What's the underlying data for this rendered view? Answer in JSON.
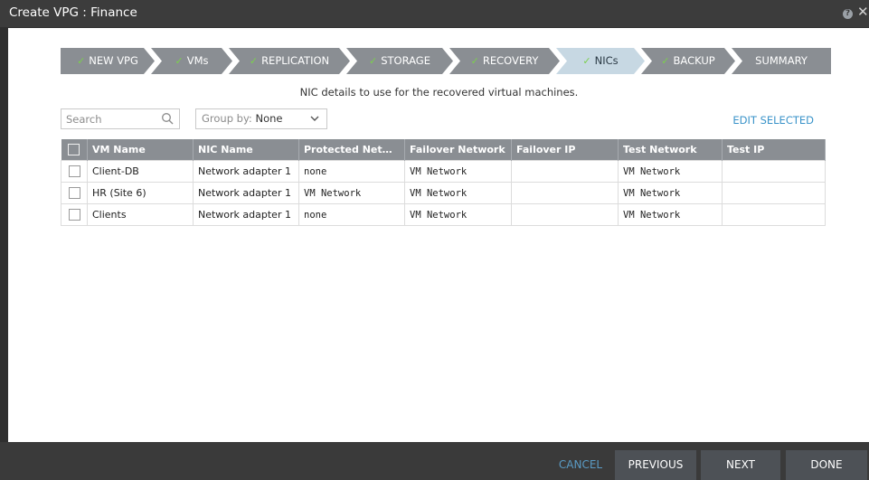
{
  "window": {
    "title": "Create VPG : Finance"
  },
  "wizard": {
    "steps": [
      {
        "label": "NEW VPG",
        "done": true
      },
      {
        "label": "VMs",
        "done": true
      },
      {
        "label": "REPLICATION",
        "done": true
      },
      {
        "label": "STORAGE",
        "done": true
      },
      {
        "label": "RECOVERY",
        "done": true
      },
      {
        "label": "NICs",
        "done": true,
        "active": true
      },
      {
        "label": "BACKUP",
        "done": true
      },
      {
        "label": "SUMMARY",
        "done": false
      }
    ],
    "check_glyph": "✓"
  },
  "subtitle": "NIC details to use for the recovered virtual machines.",
  "search": {
    "placeholder": "Search",
    "value": ""
  },
  "group_by": {
    "label": "Group by:",
    "value": "None"
  },
  "edit_selected": "EDIT SELECTED",
  "table": {
    "columns": [
      "VM Name",
      "NIC Name",
      "Protected Netw...",
      "Failover Network",
      "Failover IP",
      "Test Network",
      "Test IP"
    ],
    "rows": [
      {
        "vm": "Client-DB",
        "nic": "Network adapter 1",
        "protected": "none",
        "failover_net": "VM Network",
        "failover_ip": "",
        "test_net": "VM Network",
        "test_ip": ""
      },
      {
        "vm": "HR (Site 6)",
        "nic": "Network adapter 1",
        "protected": "VM Network",
        "failover_net": "VM Network",
        "failover_ip": "",
        "test_net": "VM Network",
        "test_ip": ""
      },
      {
        "vm": "Clients",
        "nic": "Network adapter 1",
        "protected": "none",
        "failover_net": "VM Network",
        "failover_ip": "",
        "test_net": "VM Network",
        "test_ip": ""
      }
    ]
  },
  "footer": {
    "cancel": "CANCEL",
    "previous": "PREVIOUS",
    "next": "NEXT",
    "done": "DONE"
  },
  "colors": {
    "accent": "#3a93c9",
    "check": "#7bd04c",
    "step_bg": "#8a8e93",
    "step_active_bg": "#c7d8e3"
  }
}
